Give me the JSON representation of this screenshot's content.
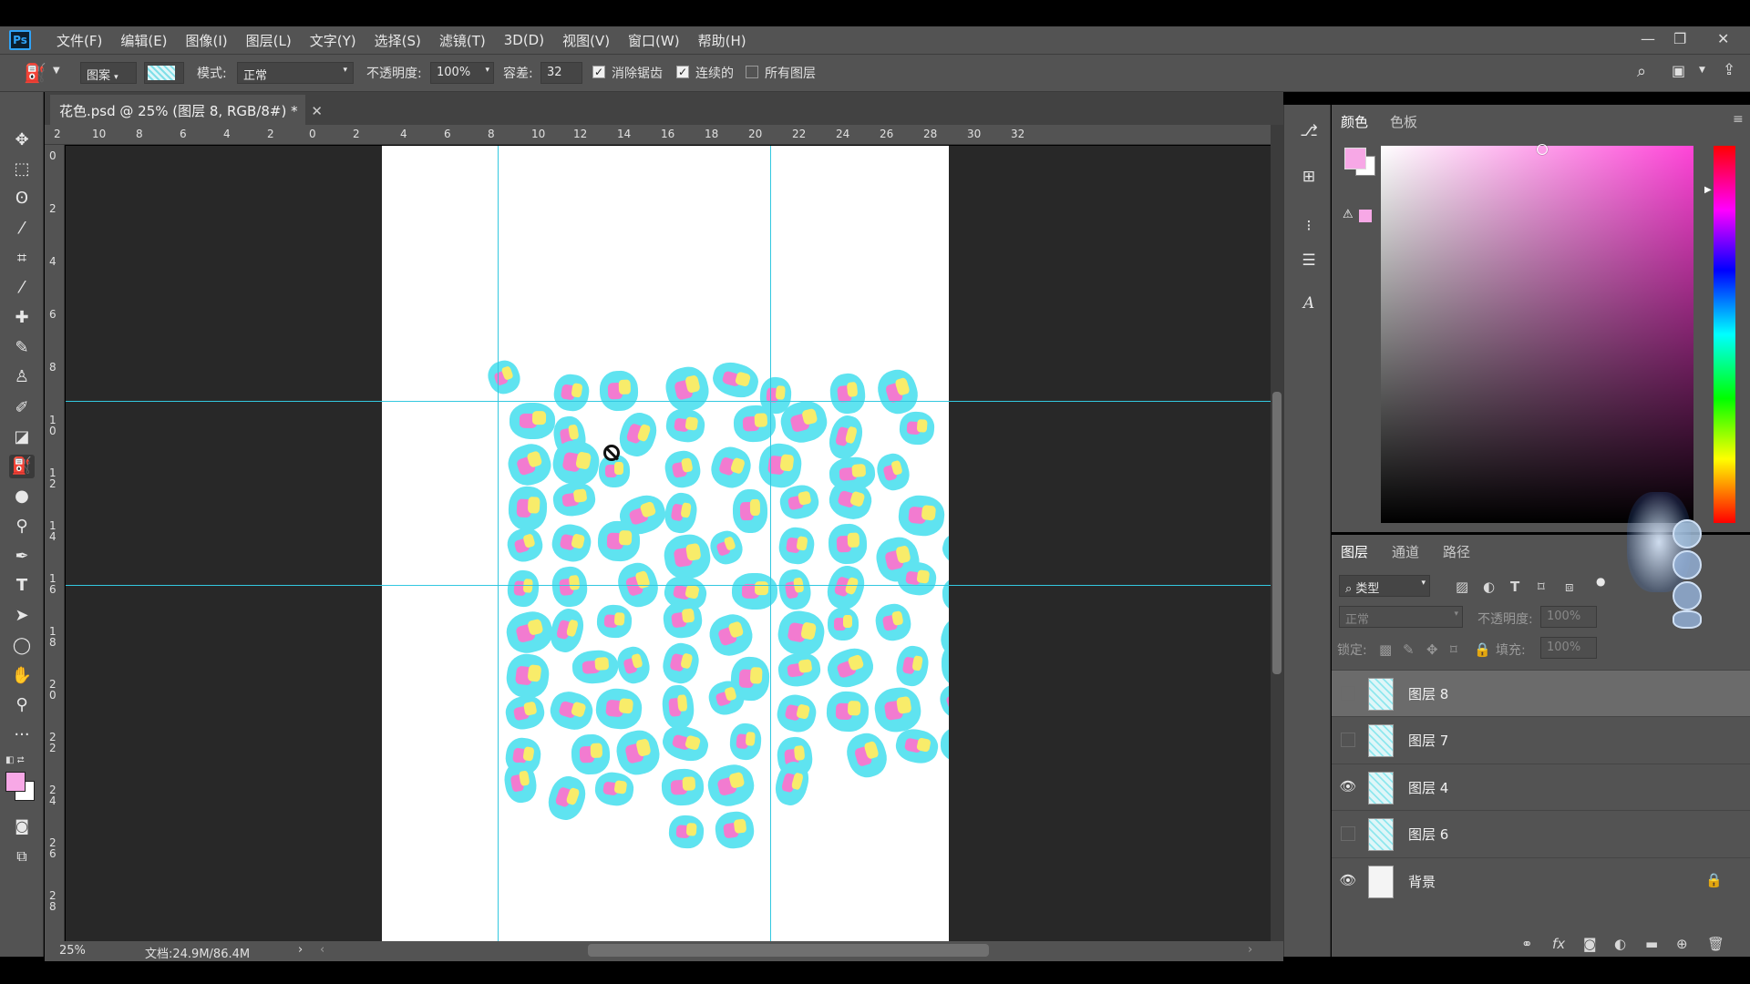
{
  "app": {
    "logo": "Ps"
  },
  "menu": [
    "文件(F)",
    "编辑(E)",
    "图像(I)",
    "图层(L)",
    "文字(Y)",
    "选择(S)",
    "滤镜(T)",
    "3D(D)",
    "视图(V)",
    "窗口(W)",
    "帮助(H)"
  ],
  "options": {
    "fill_source": "图案",
    "mode_label": "模式:",
    "mode_value": "正常",
    "opacity_label": "不透明度:",
    "opacity_value": "100%",
    "tolerance_label": "容差:",
    "tolerance_value": "32",
    "antialias_label": "消除锯齿",
    "antialias_checked": true,
    "contiguous_label": "连续的",
    "contiguous_checked": true,
    "all_layers_label": "所有图层",
    "all_layers_checked": false
  },
  "document": {
    "tab_title": "花色.psd @ 25% (图层 8, RGB/8#) *",
    "zoom": "25%",
    "doc_size": "文档:24.9M/86.4M"
  },
  "rulers": {
    "h_ticks": [
      "2",
      "10",
      "8",
      "6",
      "4",
      "2",
      "0",
      "2",
      "4",
      "6",
      "8",
      "10",
      "12",
      "14",
      "16",
      "18",
      "20",
      "22",
      "24",
      "26",
      "28",
      "30",
      "32"
    ],
    "v_ticks": [
      "0",
      "2",
      "4",
      "6",
      "8",
      "1\n0",
      "1\n2",
      "1\n4",
      "1\n6",
      "1\n8",
      "2\n0",
      "2\n2",
      "2\n4",
      "2\n6",
      "2\n8"
    ]
  },
  "color_panel": {
    "tabs": [
      "颜色",
      "色板"
    ],
    "foreground": "#f7a8e6",
    "background": "#ffffff",
    "hue_color": "#ff44d8"
  },
  "layers_panel": {
    "tabs": [
      "图层",
      "通道",
      "路径"
    ],
    "filter_label": "类型",
    "blend_mode": "正常",
    "opacity_label": "不透明度:",
    "opacity_value": "100%",
    "lock_label": "锁定:",
    "fill_label": "填充:",
    "fill_value": "100%",
    "layers": [
      {
        "name": "图层 8",
        "visible": false,
        "selected": true,
        "locked": false
      },
      {
        "name": "图层 7",
        "visible": false,
        "selected": false,
        "locked": false
      },
      {
        "name": "图层 4",
        "visible": true,
        "selected": false,
        "locked": false
      },
      {
        "name": "图层 6",
        "visible": false,
        "selected": false,
        "locked": false
      },
      {
        "name": "背景",
        "visible": true,
        "selected": false,
        "locked": true
      }
    ]
  },
  "icons": {
    "tools": [
      "move-icon",
      "marquee-icon",
      "lasso-icon",
      "magic-wand-icon",
      "crop-icon",
      "eyedropper-icon",
      "healing-icon",
      "brush-icon",
      "stamp-icon",
      "history-brush-icon",
      "eraser-icon",
      "paint-bucket-icon",
      "blur-icon",
      "dodge-icon",
      "pen-icon",
      "type-icon",
      "path-select-icon",
      "ellipse-icon",
      "hand-icon",
      "zoom-icon",
      "more-icon"
    ]
  },
  "colors": {
    "blob_cyan": "#5fe3f0",
    "blob_pink": "#f27bd0",
    "blob_yellow": "#f8ec6a",
    "guide": "#33c8e0"
  }
}
